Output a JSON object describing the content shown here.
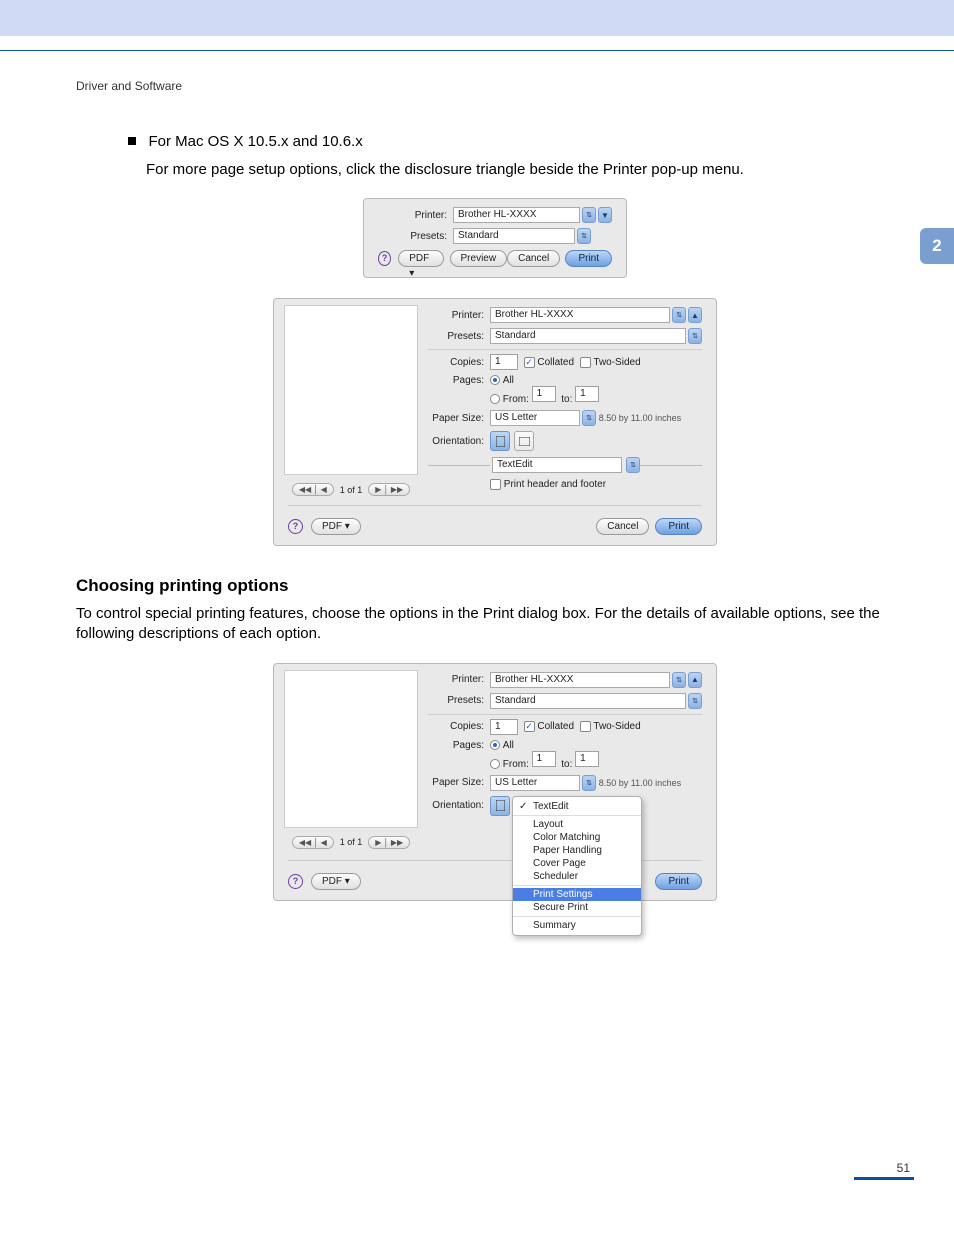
{
  "header": {
    "breadcrumb": "Driver and Software"
  },
  "tab": {
    "number": "2"
  },
  "bullet": {
    "title": "For Mac OS X 10.5.x and 10.6.x",
    "sub": "For more page setup options, click the disclosure triangle beside the Printer pop-up menu."
  },
  "dialog_small": {
    "printer_label": "Printer:",
    "printer_value": "Brother HL-XXXX",
    "presets_label": "Presets:",
    "presets_value": "Standard",
    "help_char": "?",
    "pdf_label": "PDF ▾",
    "preview_label": "Preview",
    "cancel_label": "Cancel",
    "print_label": "Print"
  },
  "dialog_big": {
    "printer_label": "Printer:",
    "printer_value": "Brother HL-XXXX",
    "presets_label": "Presets:",
    "presets_value": "Standard",
    "copies_label": "Copies:",
    "copies_value": "1",
    "collated_label": "Collated",
    "twosided_label": "Two-Sided",
    "pages_label": "Pages:",
    "pages_all": "All",
    "pages_from": "From:",
    "from_value": "1",
    "to_label": "to:",
    "to_value": "1",
    "papersize_label": "Paper Size:",
    "papersize_value": "US Letter",
    "papersize_hint": "8.50 by 11.00 inches",
    "orientation_label": "Orientation:",
    "section_value": "TextEdit",
    "print_hf_label": "Print header and footer",
    "nav_counter": "1 of 1",
    "help_char": "?",
    "pdf_label": "PDF ▾",
    "cancel_label": "Cancel",
    "print_label": "Print"
  },
  "section2": {
    "title": "Choosing printing options",
    "body": "To control special printing features, choose the options in the Print dialog box. For the details of available options, see the following descriptions of each option."
  },
  "dialog_big2": {
    "printer_label": "Printer:",
    "printer_value": "Brother HL-XXXX",
    "presets_label": "Presets:",
    "presets_value": "Standard",
    "copies_label": "Copies:",
    "copies_value": "1",
    "collated_label": "Collated",
    "twosided_label": "Two-Sided",
    "pages_label": "Pages:",
    "pages_all": "All",
    "pages_from": "From:",
    "from_value": "1",
    "to_label": "to:",
    "to_value": "1",
    "papersize_label": "Paper Size:",
    "papersize_value": "US Letter",
    "papersize_hint": "8.50 by 11.00 inches",
    "orientation_label": "Orientation:",
    "nav_counter": "1 of 1",
    "help_char": "?",
    "pdf_label": "PDF ▾",
    "print_label": "Print",
    "menu": {
      "textedit": "TextEdit",
      "layout": "Layout",
      "colormatch": "Color Matching",
      "paperhandling": "Paper Handling",
      "coverpage": "Cover Page",
      "scheduler": "Scheduler",
      "printsettings": "Print Settings",
      "secureprint": "Secure Print",
      "summary": "Summary"
    }
  },
  "page_number": "51"
}
